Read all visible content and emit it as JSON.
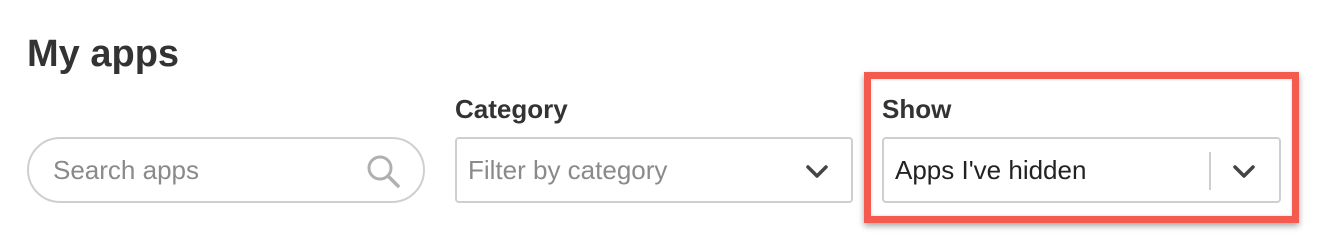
{
  "page": {
    "title": "My apps"
  },
  "search": {
    "placeholder": "Search apps",
    "value": "",
    "icon": "search-icon"
  },
  "category": {
    "label": "Category",
    "placeholder": "Filter by category",
    "icon": "chevron-down-icon"
  },
  "show": {
    "label": "Show",
    "selected": "Apps I've hidden",
    "icon": "chevron-down-icon"
  },
  "colors": {
    "highlight": "#f45a4d",
    "border": "#cfcfcf",
    "text": "#333333",
    "placeholder": "#8a8a8a"
  }
}
